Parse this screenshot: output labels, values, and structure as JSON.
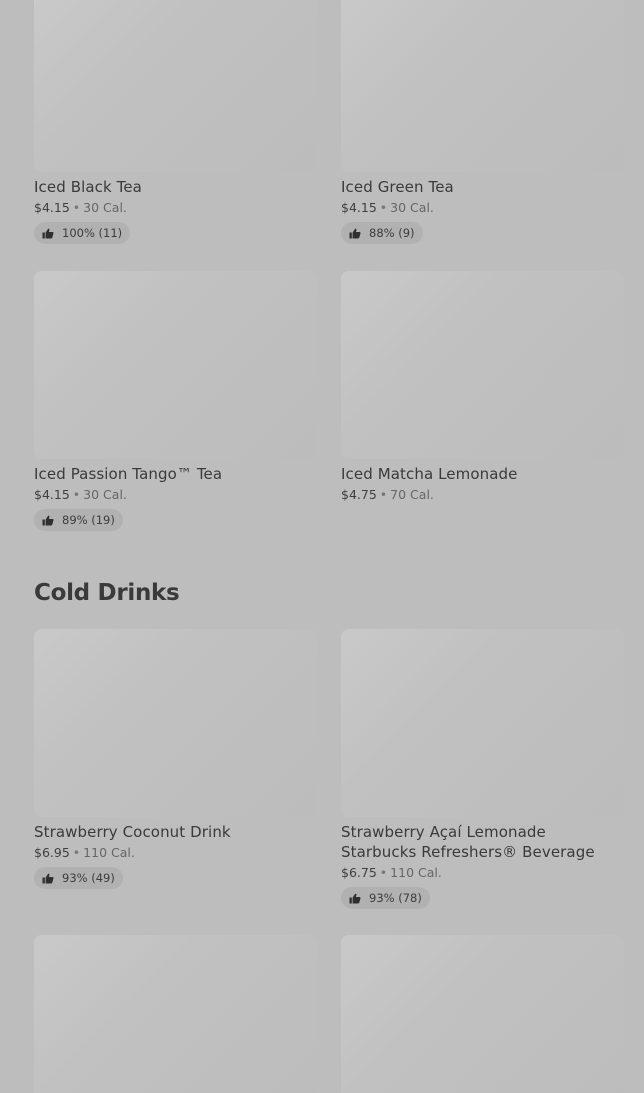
{
  "items": [
    {
      "name": "Iced Black Tea",
      "price": "$4.15",
      "cal": "30 Cal.",
      "rating": "100% (11)"
    },
    {
      "name": "Iced Green Tea",
      "price": "$4.15",
      "cal": "30 Cal.",
      "rating": "88% (9)"
    },
    {
      "name": "Iced Passion Tango™ Tea",
      "price": "$4.15",
      "cal": "30 Cal.",
      "rating": "89% (19)"
    },
    {
      "name": "Iced Matcha Lemonade",
      "price": "$4.75",
      "cal": "70 Cal."
    },
    {
      "name": "Strawberry Coconut Drink",
      "price": "$6.95",
      "cal": "110 Cal.",
      "rating": "93% (49)"
    },
    {
      "name": "Strawberry Açaí Lemonade Starbucks Refreshers® Beverage",
      "price": "$6.75",
      "cal": "110 Cal.",
      "rating": "93% (78)"
    }
  ],
  "sections": {
    "cold_drinks": "Cold Drinks"
  },
  "separator": "•",
  "icons": {
    "rating": "thumbs-up-icon"
  }
}
